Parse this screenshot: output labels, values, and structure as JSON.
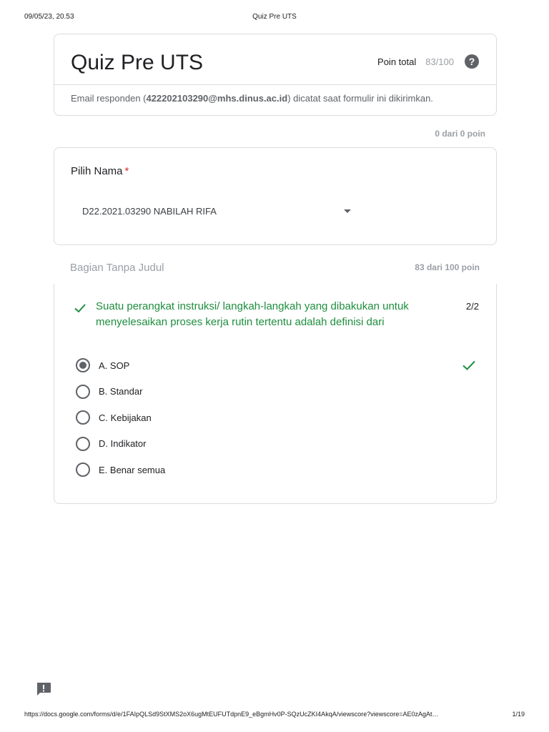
{
  "print_header": {
    "datetime": "09/05/23, 20.53",
    "title": "Quiz Pre UTS"
  },
  "form": {
    "title": "Quiz Pre UTS",
    "points_label": "Poin total",
    "points_value": "83/100",
    "help_icon": "question-circle-icon",
    "email_prefix": "Email responden (",
    "email": "422202103290@mhs.dinus.ac.id",
    "email_suffix": ") dicatat saat formulir ini dikirimkan."
  },
  "name_section": {
    "points_summary": "0 dari 0 poin",
    "label": "Pilih Nama",
    "required": "*",
    "selected_value": "D22.2021.03290 NABILAH RIFA"
  },
  "section": {
    "title": "Bagian Tanpa Judul",
    "points": "83 dari 100 poin"
  },
  "question": {
    "text": "Suatu perangkat instruksi/ langkah-langkah yang dibakukan untuk menyelesaikan proses kerja rutin tertentu adalah definisi dari",
    "score": "2/2",
    "status_color": "#1e8e3e",
    "options": [
      {
        "label": "A. SOP",
        "selected": true,
        "correct": true
      },
      {
        "label": "B. Standar",
        "selected": false,
        "correct": false
      },
      {
        "label": "C. Kebijakan",
        "selected": false,
        "correct": false
      },
      {
        "label": "D. Indikator",
        "selected": false,
        "correct": false
      },
      {
        "label": "E. Benar semua",
        "selected": false,
        "correct": false
      }
    ]
  },
  "print_footer": {
    "url": "https://docs.google.com/forms/d/e/1FAIpQLSd9StXMS2oX6ugMtEUFUTdpnE9_eBgmHv0P-SQzUcZKI4AkqA/viewscore?viewscore=AE0zAgAt…",
    "page": "1/19"
  }
}
